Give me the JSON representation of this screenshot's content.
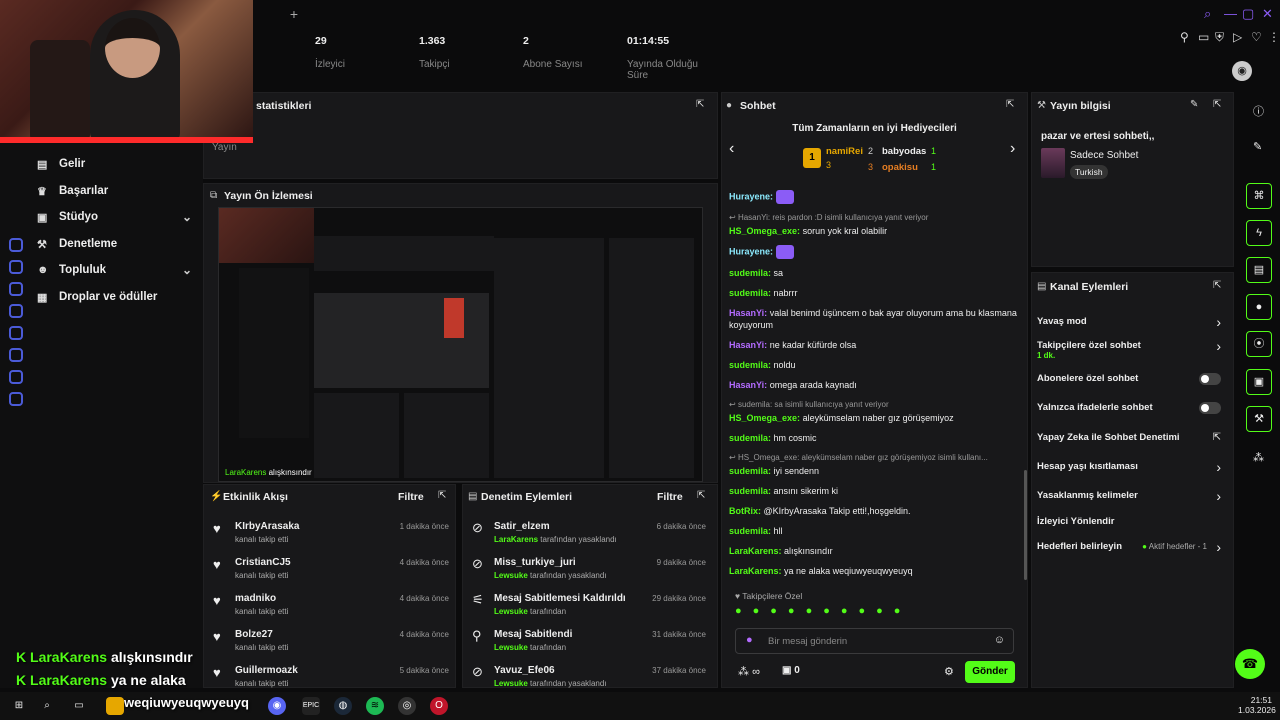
{
  "stats": {
    "title": "statistikleri",
    "items": [
      {
        "label": "Yayın",
        "value": ""
      },
      {
        "label": "İzleyici",
        "value": "29"
      },
      {
        "label": "Takipçi",
        "value": "1.363"
      },
      {
        "label": "Abone Sayısı",
        "value": "2"
      },
      {
        "label": "Yayında Olduğu Süre",
        "value": "01:14:55"
      }
    ]
  },
  "sidebar": {
    "items": [
      {
        "label": "Gelir",
        "icon": "revenue-icon"
      },
      {
        "label": "Başarılar",
        "icon": "trophy-icon"
      },
      {
        "label": "Stüdyo",
        "icon": "studio-icon"
      },
      {
        "label": "Denetleme",
        "icon": "hammer-icon"
      },
      {
        "label": "Topluluk",
        "icon": "community-icon"
      },
      {
        "label": "Droplar ve ödüller",
        "icon": "gift-icon"
      }
    ]
  },
  "preview": {
    "title": "Yayın Ön İzlemesi",
    "overlay_user": "LaraKarens",
    "overlay_text": "alışkınsındır"
  },
  "activity": {
    "title": "Etkinlik Akışı",
    "filter": "Filtre",
    "items": [
      {
        "name": "KIrbyArasaka",
        "sub": "kanalı takip etti",
        "time": "1 dakika önce"
      },
      {
        "name": "CristianCJ5",
        "sub": "kanalı takip etti",
        "time": "4 dakika önce"
      },
      {
        "name": "madniko",
        "sub": "kanalı takip etti",
        "time": "4 dakika önce"
      },
      {
        "name": "Bolze27",
        "sub": "kanalı takip etti",
        "time": "4 dakika önce"
      },
      {
        "name": "Guillermoazk",
        "sub": "kanalı takip etti",
        "time": "5 dakika önce"
      }
    ]
  },
  "moderation": {
    "title": "Denetim Eylemleri",
    "filter": "Filtre",
    "items": [
      {
        "name": "Satir_elzem",
        "by": "LaraKarens",
        "sub": "tarafından yasaklandı",
        "time": "6 dakika önce",
        "icon": "ban-icon"
      },
      {
        "name": "Miss_turkiye_juri",
        "by": "Lewsuke",
        "sub": "tarafından yasaklandı",
        "time": "9 dakika önce",
        "icon": "ban-icon"
      },
      {
        "name": "Mesaj Sabitlemesi Kaldırıldı",
        "by": "Lewsuke",
        "sub": "tarafından",
        "time": "29 dakika önce",
        "icon": "unpin-icon"
      },
      {
        "name": "Mesaj Sabitlendi",
        "by": "Lewsuke",
        "sub": "tarafından",
        "time": "31 dakika önce",
        "icon": "pin-icon"
      },
      {
        "name": "Yavuz_Efe06",
        "by": "Lewsuke",
        "sub": "tarafından yasaklandı",
        "time": "37 dakika önce",
        "icon": "ban-icon"
      }
    ]
  },
  "chat": {
    "title": "Sohbet",
    "gifters_title": "Tüm Zamanların en iyi Hediyecileri",
    "gifters": [
      {
        "rank": "1",
        "name": "namiRei",
        "count": "3"
      },
      {
        "rank": "2",
        "name": "babyodas",
        "count": "1"
      },
      {
        "rank": "3",
        "name": "opakisu",
        "count": "1"
      }
    ],
    "messages": [
      {
        "user": "Hurayene:",
        "text": "",
        "color": "#8be9fd",
        "reply": ""
      },
      {
        "user": "HS_Omega_exe:",
        "text": "sorun yok kral olabilir",
        "color": "#53fc18",
        "reply": "HasanYi: reis pardon :D isimli kullanıcıya yanıt veriyor"
      },
      {
        "user": "Hurayene:",
        "text": "",
        "color": "#8be9fd",
        "reply": ""
      },
      {
        "user": "sudemila:",
        "text": "sa",
        "color": "#53fc18",
        "reply": ""
      },
      {
        "user": "sudemila:",
        "text": "nabrrr",
        "color": "#53fc18",
        "reply": ""
      },
      {
        "user": "HasanYi:",
        "text": "valal benimd üşüncem o bak ayar oluyorum ama bu klasmana koyuyorum",
        "color": "#b36bff",
        "reply": ""
      },
      {
        "user": "HasanYi:",
        "text": "ne kadar küfürde olsa",
        "color": "#b36bff",
        "reply": ""
      },
      {
        "user": "sudemila:",
        "text": "noldu",
        "color": "#53fc18",
        "reply": ""
      },
      {
        "user": "HasanYi:",
        "text": "omega arada kaynadı",
        "color": "#b36bff",
        "reply": ""
      },
      {
        "user": "HS_Omega_exe:",
        "text": "aleykümselam naber gız görüşemiyoz",
        "color": "#53fc18",
        "reply": "sudemila: sa isimli kullanıcıya yanıt veriyor"
      },
      {
        "user": "sudemila:",
        "text": "hm cosmic",
        "color": "#53fc18",
        "reply": ""
      },
      {
        "user": "sudemila:",
        "text": "iyi sendenn",
        "color": "#53fc18",
        "reply": "HS_Omega_exe: aleykümselam naber gız görüşemiyoz isimli kullanı..."
      },
      {
        "user": "sudemila:",
        "text": "ansını sikerim ki",
        "color": "#53fc18",
        "reply": ""
      },
      {
        "user": "BotRix:",
        "text": "@KIrbyArasaka Takip etti!,hoşgeldin.",
        "color": "#53fc18",
        "reply": ""
      },
      {
        "user": "sudemila:",
        "text": "hll",
        "color": "#53fc18",
        "reply": ""
      },
      {
        "user": "LaraKarens:",
        "text": "alışkınsındır",
        "color": "#53fc18",
        "reply": ""
      },
      {
        "user": "LaraKarens:",
        "text": "ya ne alaka weqiuwyeuqwyeuyq",
        "color": "#53fc18",
        "reply": ""
      }
    ],
    "followers_only": "Takipçilere Özel",
    "input_placeholder": "Bir mesaj gönderin",
    "points": "∞",
    "gift_count": "0",
    "send_label": "Gönder"
  },
  "stream_info": {
    "title": "Yayın bilgisi",
    "stream_title": "pazar ve ertesi sohbeti,,",
    "category": "Sadece Sohbet",
    "language": "Turkish"
  },
  "channel_actions": {
    "title": "Kanal Eylemleri",
    "items": [
      {
        "label": "Yavaş mod",
        "sub": "",
        "control": "chevron"
      },
      {
        "label": "Takipçilere özel sohbet",
        "sub": "1 dk.",
        "control": "chevron"
      },
      {
        "label": "Abonelere özel sohbet",
        "sub": "",
        "control": "toggle"
      },
      {
        "label": "Yalnızca ifadelerle sohbet",
        "sub": "",
        "control": "toggle"
      },
      {
        "label": "Yapay Zeka ile Sohbet Denetimi",
        "sub": "",
        "control": "external"
      },
      {
        "label": "Hesap yaşı kısıtlaması",
        "sub": "",
        "control": "chevron"
      },
      {
        "label": "Yasaklanmış kelimeler",
        "sub": "",
        "control": "chevron"
      },
      {
        "label": "İzleyici Yönlendir",
        "sub": "",
        "control": "none"
      },
      {
        "label": "Hedefleri belirleyin",
        "sub": "Aktif hedefler - 1",
        "control": "chevron"
      }
    ]
  },
  "overlay": [
    {
      "user": "LaraKarens",
      "text": "alışkınsındır"
    },
    {
      "user": "LaraKarens",
      "text": "ya ne alaka"
    }
  ],
  "overlay_tail": "weqiuwyeuqwyeuyq",
  "clock": {
    "time": "21:51",
    "date": "1.03.2026"
  },
  "colors": {
    "accent": "#53fc18",
    "bg": "#0b0b0c",
    "card": "#18181a"
  }
}
